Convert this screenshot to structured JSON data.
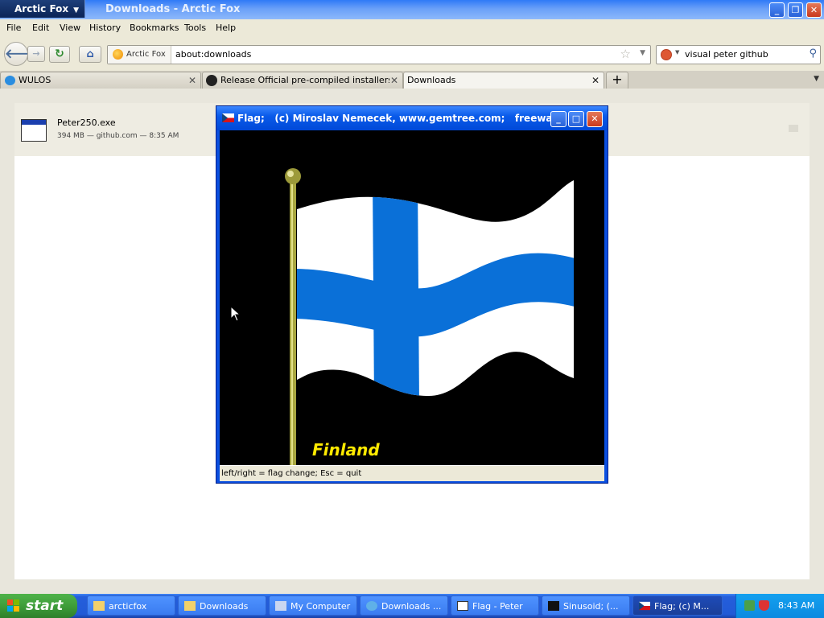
{
  "browser": {
    "app_button": "Arctic Fox",
    "window_title": "Downloads - Arctic Fox",
    "menu": [
      "File",
      "Edit",
      "View",
      "History",
      "Bookmarks",
      "Tools",
      "Help"
    ],
    "identity_label": "Arctic Fox",
    "url": "about:downloads",
    "search_value": "visual peter github",
    "tabs": [
      {
        "label": "WULOS",
        "active": false
      },
      {
        "label": "Release Official pre-compiled installers fo...",
        "active": false
      },
      {
        "label": "Downloads",
        "active": true
      }
    ]
  },
  "downloads": {
    "items": [
      {
        "filename": "Peter250.exe",
        "meta": "394 MB — github.com — 8:35 AM"
      }
    ]
  },
  "flag_window": {
    "title": "Flag;   (c) Miroslav Nemecek, www.gemtree.com;   freeware",
    "country": "Finland",
    "status": "left/right = flag change;   Esc = quit",
    "flag_colors": {
      "white": "#ffffff",
      "blue": "#0a70d8",
      "background": "#000000",
      "pole": "#9c9a3a"
    }
  },
  "taskbar": {
    "start_label": "start",
    "items": [
      {
        "label": "arcticfox",
        "active": false
      },
      {
        "label": "Downloads",
        "active": false
      },
      {
        "label": "My Computer",
        "active": false
      },
      {
        "label": "Downloads ...",
        "active": false
      },
      {
        "label": "Flag - Peter",
        "active": false
      },
      {
        "label": "Sinusoid;   (...",
        "active": false
      },
      {
        "label": "Flag;   (c) M...",
        "active": true
      }
    ],
    "clock": "8:43 AM"
  }
}
